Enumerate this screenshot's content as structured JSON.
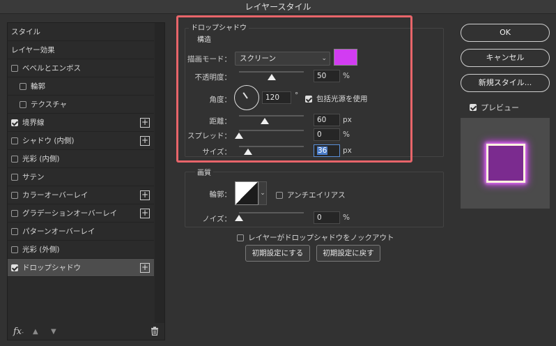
{
  "window": {
    "title": "レイヤースタイル"
  },
  "left": {
    "items": [
      {
        "label": "スタイル",
        "type": "header"
      },
      {
        "label": "レイヤー効果",
        "type": "header"
      },
      {
        "label": "ベベルとエンボス",
        "type": "check",
        "checked": false
      },
      {
        "label": "輪郭",
        "type": "sub",
        "checked": false
      },
      {
        "label": "テクスチャ",
        "type": "sub",
        "checked": false
      },
      {
        "label": "境界線",
        "type": "check",
        "checked": true,
        "plus": true
      },
      {
        "label": "シャドウ (内側)",
        "type": "check",
        "checked": false,
        "plus": true
      },
      {
        "label": "光彩 (内側)",
        "type": "check",
        "checked": false
      },
      {
        "label": "サテン",
        "type": "check",
        "checked": false
      },
      {
        "label": "カラーオーバーレイ",
        "type": "check",
        "checked": false,
        "plus": true
      },
      {
        "label": "グラデーションオーバーレイ",
        "type": "check",
        "checked": false,
        "plus": true
      },
      {
        "label": "パターンオーバーレイ",
        "type": "check",
        "checked": false
      },
      {
        "label": "光彩 (外側)",
        "type": "check",
        "checked": false
      },
      {
        "label": "ドロップシャドウ",
        "type": "check",
        "checked": true,
        "plus": true,
        "selected": true
      }
    ],
    "plus_glyph": "+",
    "footer": {
      "fx": "fx",
      "fx_sub": "-",
      "up_icon": "▲",
      "down_icon": "▼",
      "trash_icon": "trash-icon"
    }
  },
  "drop_shadow": {
    "title": "ドロップシャドウ",
    "structure_title": "構造",
    "blend_mode_label": "描画モード：",
    "blend_mode_value": "スクリーン",
    "blend_color": "#d23cf2",
    "opacity_label": "不透明度：",
    "opacity_value": "50",
    "opacity_fraction": 0.5,
    "angle_label": "角度：",
    "angle_value": "120",
    "angle_unit": "°",
    "global_light_label": "包括光源を使用",
    "global_light_checked": true,
    "distance_label": "距離：",
    "distance_value": "60",
    "distance_fraction": 0.4,
    "spread_label": "スプレッド：",
    "spread_value": "0",
    "spread_fraction": 0,
    "size_label": "サイズ：",
    "size_value": "36",
    "size_fraction": 0.14,
    "unit_px": "px",
    "unit_pct": "%"
  },
  "quality": {
    "title": "画質",
    "contour_label": "輪郭：",
    "antialias_label": "アンチエイリアス",
    "noise_label": "ノイズ：",
    "noise_value": "0",
    "noise_fraction": 0,
    "unit_pct": "%"
  },
  "knockout_label": "レイヤーがドロップシャドウをノックアウト",
  "buttons": {
    "make_default": "初期設定にする",
    "reset_default": "初期設定に戻す",
    "ok": "OK",
    "cancel": "キャンセル",
    "new_style": "新規スタイル...",
    "preview_label": "プレビュー"
  }
}
